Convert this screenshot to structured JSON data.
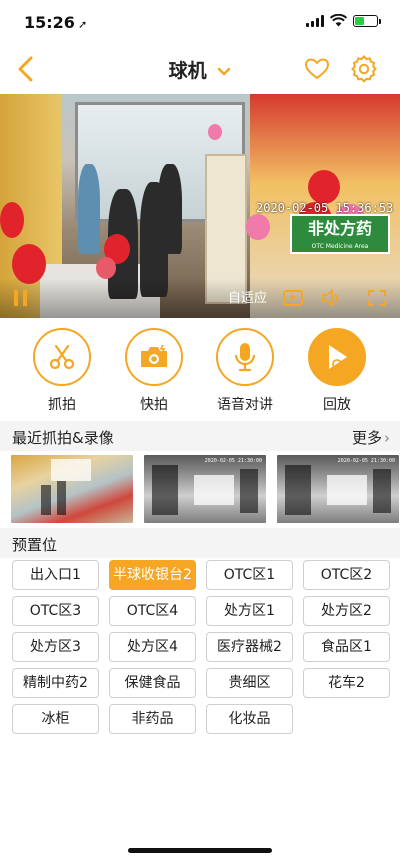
{
  "status_bar": {
    "time": "15:26",
    "location_arrow": "➚",
    "battery_level": 0.45,
    "battery_color": "#2ecc40"
  },
  "nav": {
    "title": "球机",
    "back_icon": "chevron-left-icon",
    "favorite_icon": "heart-icon",
    "settings_icon": "gear-icon",
    "accent_color": "#f5a623"
  },
  "video": {
    "timestamp": "2020-02-05 15:36:53",
    "sign_text": "非处方药",
    "sign_subtext": "OTC Medicine Area",
    "mode_label": "自适应",
    "icons": [
      "pause-icon",
      "screenshot-icon",
      "volume-icon",
      "fullscreen-icon"
    ]
  },
  "actions": [
    {
      "label": "抓拍",
      "icon": "scissors-icon"
    },
    {
      "label": "快拍",
      "icon": "camera-icon"
    },
    {
      "label": "语音对讲",
      "icon": "microphone-icon"
    },
    {
      "label": "回放",
      "icon": "playback-icon"
    }
  ],
  "recent": {
    "title": "最近抓拍&录像",
    "more_label": "更多",
    "thumbnails": [
      {
        "kind": "color",
        "timestamp": ""
      },
      {
        "kind": "gray",
        "timestamp": "2020-02-05 21:30:00"
      },
      {
        "kind": "gray",
        "timestamp": "2020-02-05 21:30:00"
      }
    ]
  },
  "presets": {
    "title": "预置位",
    "active_index": 1,
    "items": [
      "出入口1",
      "半球收银台2",
      "OTC区1",
      "OTC区2",
      "OTC区3",
      "OTC区4",
      "处方区1",
      "处方区2",
      "处方区3",
      "处方区4",
      "医疗器械2",
      "食品区1",
      "精制中药2",
      "保健食品",
      "贵细区",
      "花车2",
      "冰柜",
      "非药品",
      "化妆品"
    ]
  }
}
